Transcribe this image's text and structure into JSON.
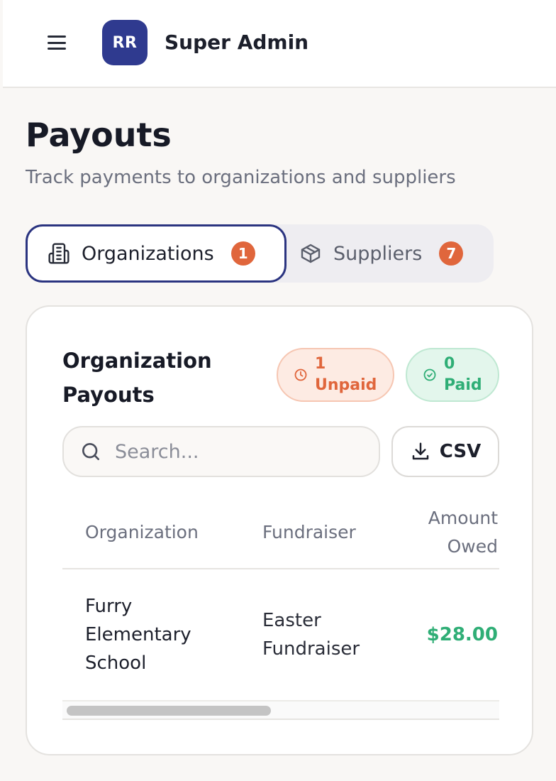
{
  "header": {
    "avatar_initials": "RR",
    "user_name": "Super Admin",
    "brand_color": "#2f3a8f"
  },
  "page": {
    "title": "Payouts",
    "subtitle": "Track payments to organizations and suppliers"
  },
  "tabs": [
    {
      "label": "Organizations",
      "count": "1",
      "icon": "building-icon",
      "active": true
    },
    {
      "label": "Suppliers",
      "count": "7",
      "icon": "package-icon",
      "active": false
    }
  ],
  "card": {
    "title": "Organization Payouts",
    "unpaid": {
      "count": "1",
      "label": "Unpaid",
      "color": "#e0663c"
    },
    "paid": {
      "count": "0",
      "label": "Paid",
      "color": "#2fae76"
    },
    "search": {
      "placeholder": "Search...",
      "value": ""
    },
    "csv_label": "CSV",
    "table": {
      "columns": [
        "Organization",
        "Fundraiser",
        "Amount Owed"
      ],
      "rows": [
        {
          "organization": "Furry Elementary School",
          "fundraiser": "Easter Fundraiser",
          "amount_owed": "$28.00"
        }
      ]
    }
  }
}
